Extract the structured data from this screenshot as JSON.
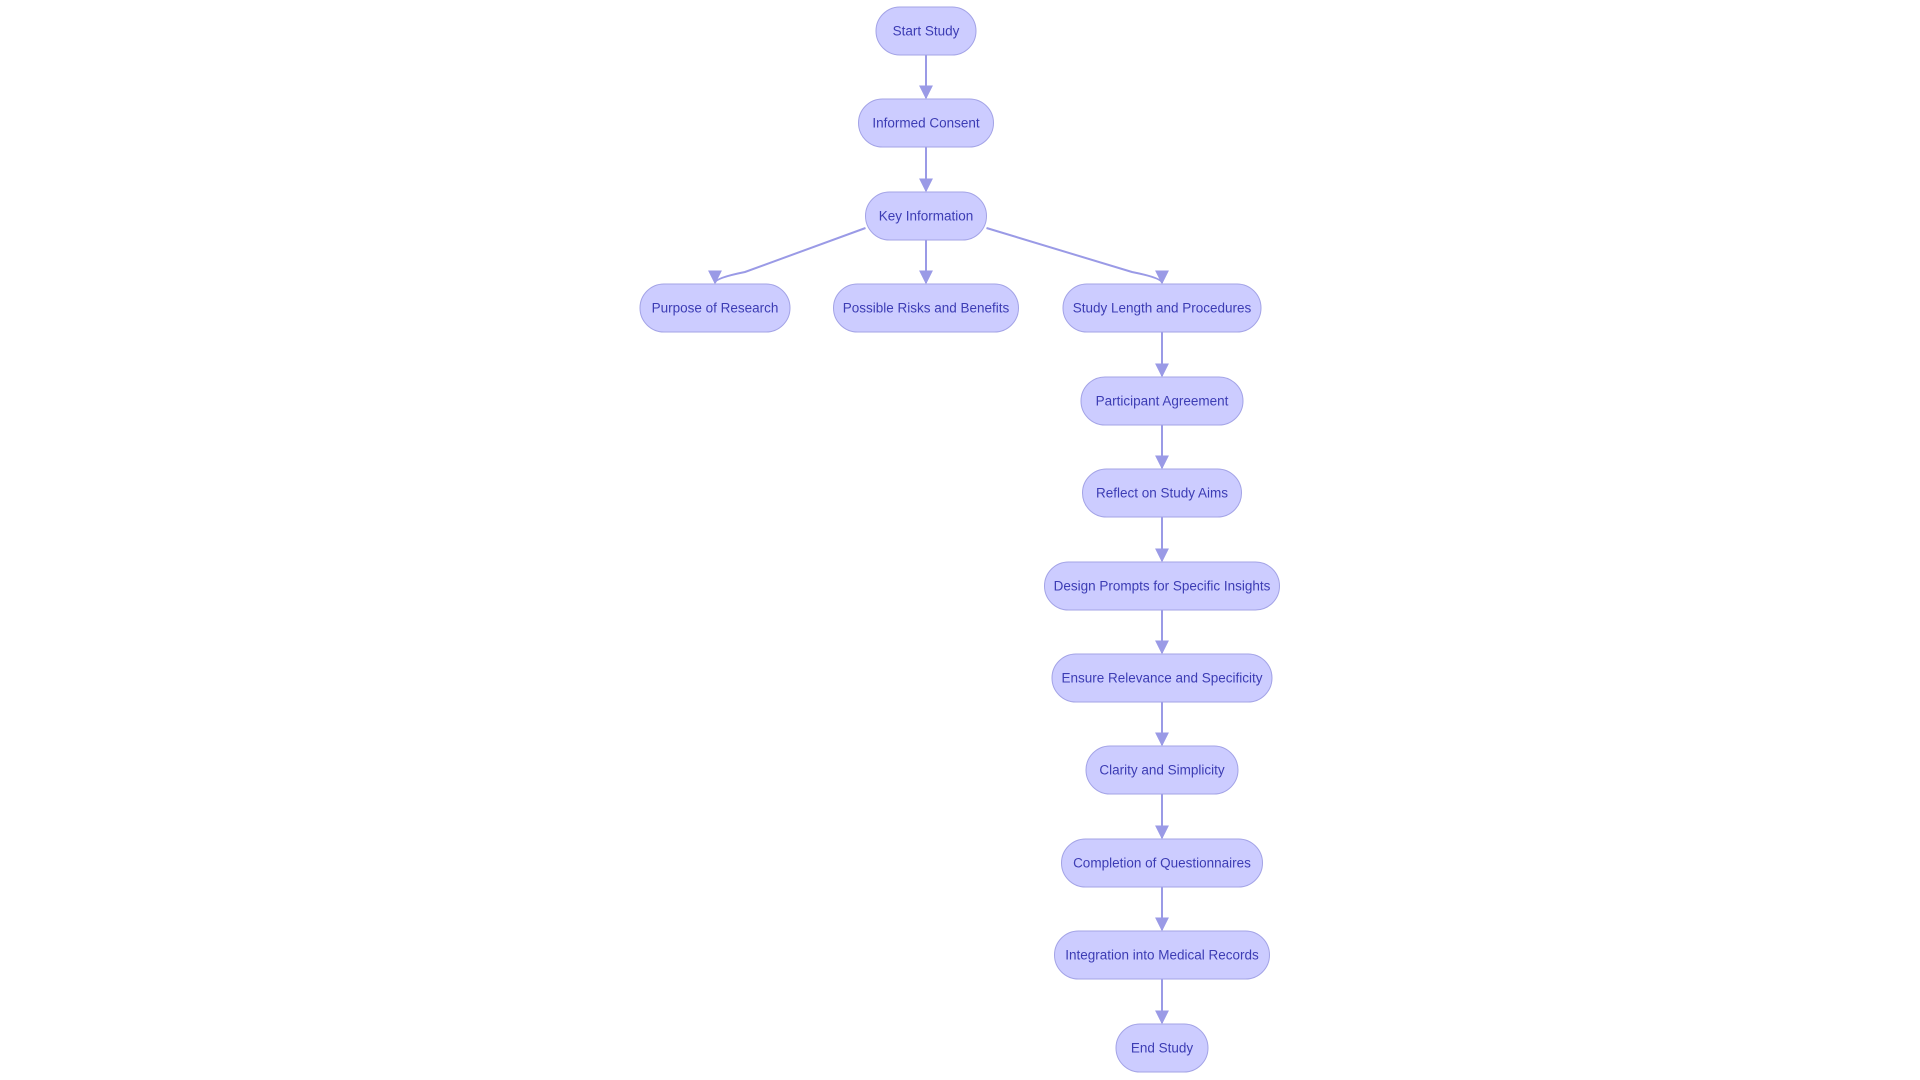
{
  "diagram": {
    "type": "flowchart",
    "direction": "top-down",
    "colors": {
      "node_fill": "#ccccff",
      "node_stroke": "#a3a3e6",
      "text": "#3c3cb4",
      "edge": "#9a9ae6"
    },
    "nodes": [
      {
        "id": "start",
        "label": "Start Study"
      },
      {
        "id": "consent",
        "label": "Informed Consent"
      },
      {
        "id": "key",
        "label": "Key Information"
      },
      {
        "id": "purpose",
        "label": "Purpose of Research"
      },
      {
        "id": "risks",
        "label": "Possible Risks and Benefits"
      },
      {
        "id": "length",
        "label": "Study Length and Procedures"
      },
      {
        "id": "agreement",
        "label": "Participant Agreement"
      },
      {
        "id": "reflect",
        "label": "Reflect on Study Aims"
      },
      {
        "id": "design",
        "label": "Design Prompts for Specific Insights"
      },
      {
        "id": "ensure",
        "label": "Ensure Relevance and Specificity"
      },
      {
        "id": "clarity",
        "label": "Clarity and Simplicity"
      },
      {
        "id": "completion",
        "label": "Completion of Questionnaires"
      },
      {
        "id": "integration",
        "label": "Integration into Medical Records"
      },
      {
        "id": "end",
        "label": "End Study"
      }
    ],
    "edges": [
      [
        "start",
        "consent"
      ],
      [
        "consent",
        "key"
      ],
      [
        "key",
        "purpose"
      ],
      [
        "key",
        "risks"
      ],
      [
        "key",
        "length"
      ],
      [
        "length",
        "agreement"
      ],
      [
        "agreement",
        "reflect"
      ],
      [
        "reflect",
        "design"
      ],
      [
        "design",
        "ensure"
      ],
      [
        "ensure",
        "clarity"
      ],
      [
        "clarity",
        "completion"
      ],
      [
        "completion",
        "integration"
      ],
      [
        "integration",
        "end"
      ]
    ]
  }
}
